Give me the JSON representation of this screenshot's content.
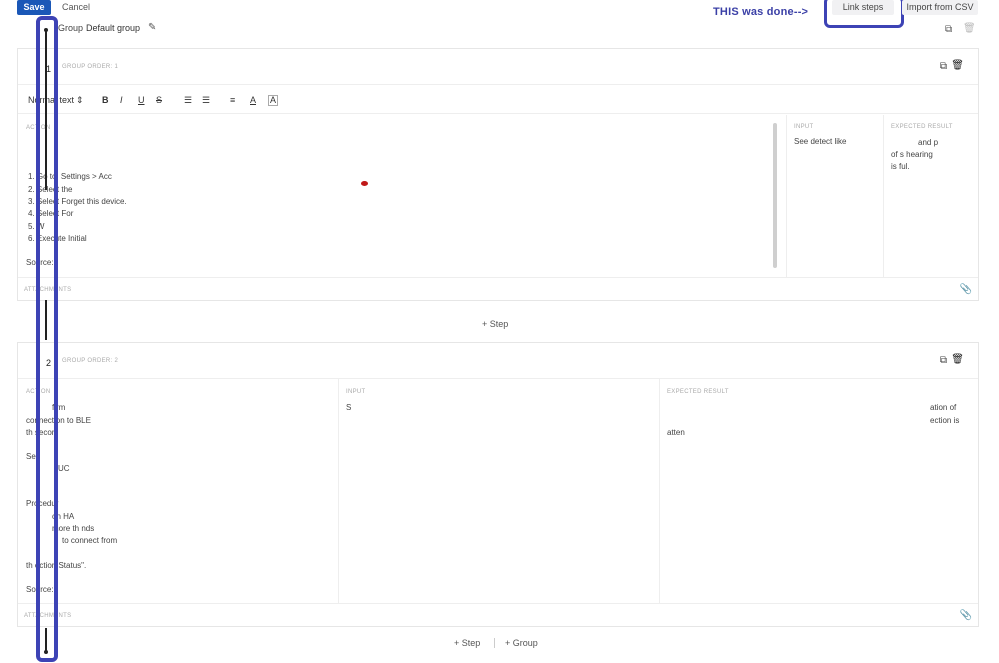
{
  "topbar": {
    "save_label": "Save",
    "cancel_label": "Cancel",
    "annotation_text": "THIS was done-->",
    "link_steps_label": "Link steps",
    "import_csv_label": "Import from CSV"
  },
  "group": {
    "prefix": "Group",
    "name": "Default group"
  },
  "steps": [
    {
      "number": "1",
      "group_order": "GROUP ORDER: 1",
      "toolbar": {
        "format": "Normal text",
        "bold": "B",
        "italic": "I",
        "underline": "U",
        "strike": "S"
      },
      "action_label": "ACTION",
      "action_lines": [
        "1. Go to: Settings > Acc",
        "2. Select the",
        "3. Select Forget this device.",
        "4. Select For",
        "5. W",
        "6. Execute Initial"
      ],
      "action_source": "Source:",
      "input_label": "INPUT",
      "input_lines": [
        "See detect like"
      ],
      "expected_label": "EXPECTED RESULT",
      "expected_lines": [
        "and p",
        "of s hearing",
        "is ful."
      ],
      "attachments_label": "ATTACHMENTS"
    },
    {
      "number": "2",
      "group_order": "GROUP ORDER: 2",
      "action_label": "ACTION",
      "action_lines": [
        "firm",
        "connection to BLE",
        "th secon",
        "",
        "Se",
        "UC",
        "",
        "",
        "Procedur",
        "on HA",
        "more th nds",
        "to connect from",
        "",
        "th ection Status\"."
      ],
      "action_source": "Source:",
      "input_label": "INPUT",
      "input_lines": [
        "S"
      ],
      "expected_label": "EXPECTED RESULT",
      "expected_lines": [
        "ation of",
        "ection is",
        "atten"
      ],
      "attachments_label": "ATTACHMENTS"
    }
  ],
  "add_step_label": "+  Step",
  "bottom": {
    "add_step_label": "+  Step",
    "add_group_label": "+  Group"
  }
}
